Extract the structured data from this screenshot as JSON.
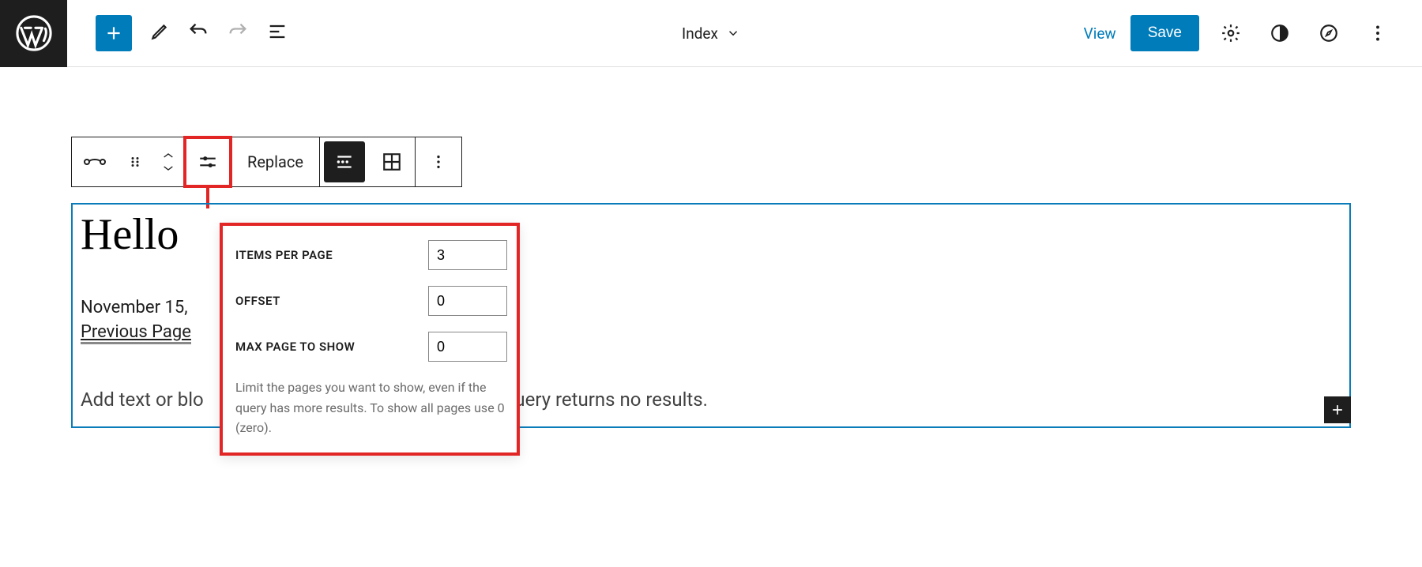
{
  "header": {
    "template_name": "Index",
    "view_label": "View",
    "save_label": "Save"
  },
  "block_toolbar": {
    "replace_label": "Replace"
  },
  "popover": {
    "items_per_page_label": "Items Per Page",
    "items_per_page_value": "3",
    "offset_label": "Offset",
    "offset_value": "0",
    "max_page_label": "Max page to show",
    "max_page_value": "0",
    "help_text": "Limit the pages you want to show, even if the query has more results. To show all pages use 0 (zero)."
  },
  "content": {
    "post_title": "Hello",
    "post_date": "November 15,",
    "prev_page_label": "Previous Page",
    "no_results_prefix": "Add text or blo",
    "no_results_suffix": "query returns no results."
  }
}
